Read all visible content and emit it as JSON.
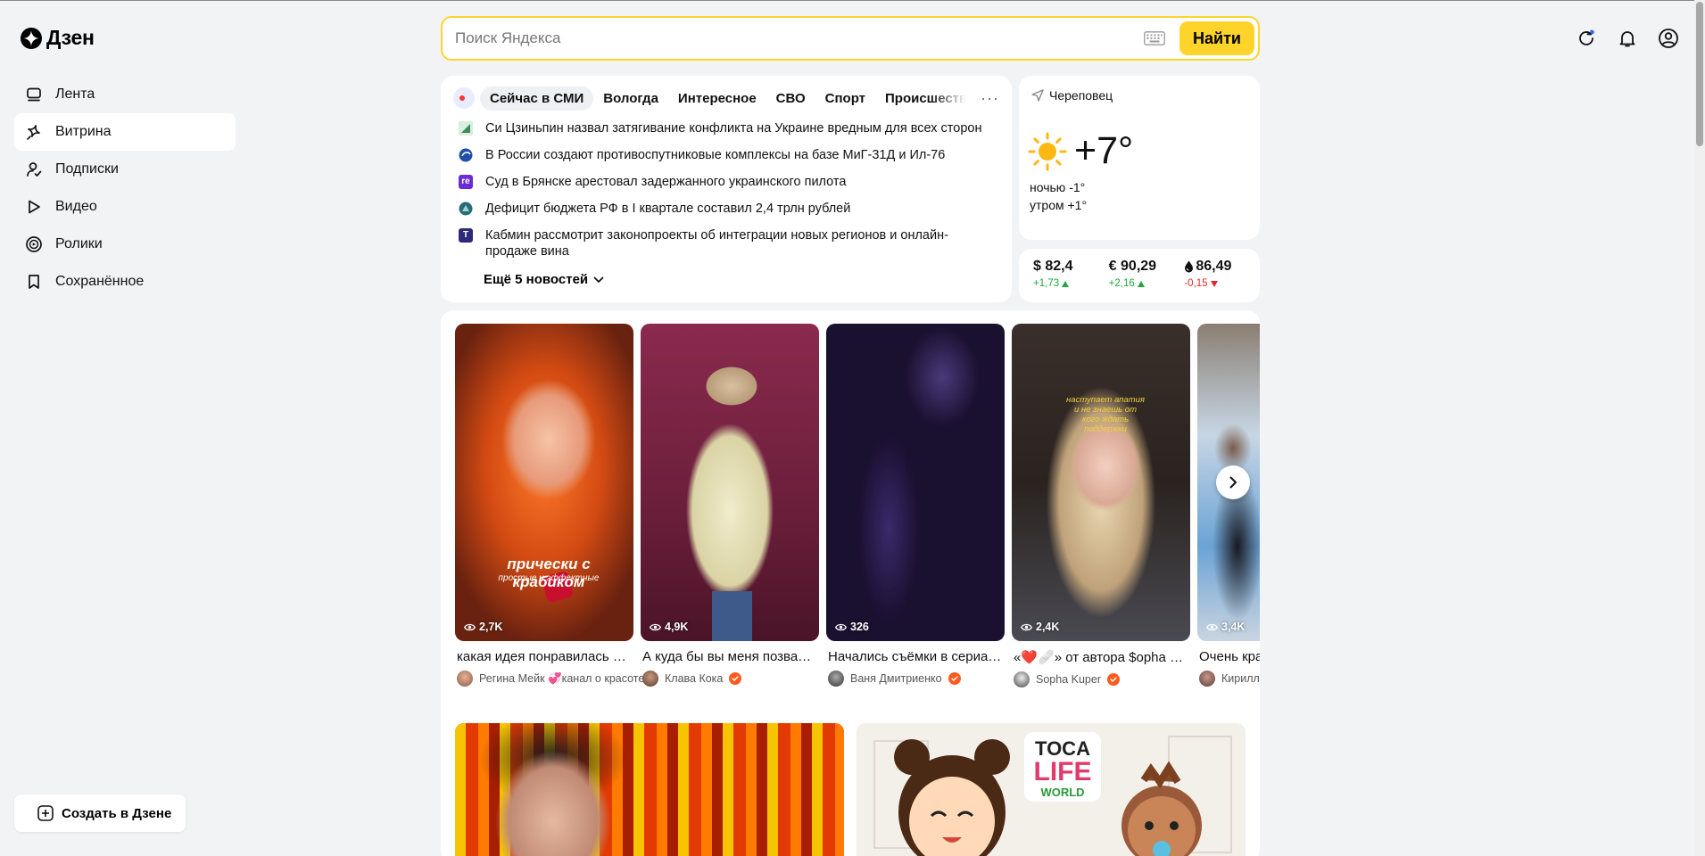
{
  "brand": {
    "name": "Дзен"
  },
  "sidebar": {
    "items": [
      {
        "label": "Лента",
        "icon": "feed-icon"
      },
      {
        "label": "Витрина",
        "icon": "sparkles-icon",
        "active": true
      },
      {
        "label": "Подписки",
        "icon": "subscriptions-icon"
      },
      {
        "label": "Видео",
        "icon": "play-icon"
      },
      {
        "label": "Ролики",
        "icon": "shorts-icon"
      },
      {
        "label": "Сохранённое",
        "icon": "bookmark-icon"
      }
    ],
    "create_label": "Создать в Дзене"
  },
  "search": {
    "placeholder": "Поиск Яндекса",
    "value": "",
    "button_label": "Найти",
    "accent": "#fed42b"
  },
  "header_icons": [
    "refresh-icon",
    "bell-icon",
    "profile-icon"
  ],
  "news": {
    "tabs": [
      "Сейчас в СМИ",
      "Вологда",
      "Интересное",
      "СВО",
      "Спорт",
      "Происшествия"
    ],
    "active_tab": 0,
    "items": [
      {
        "text": "Си Цзиньпин назвал затягивание конфликта на Украине вредным для всех сторон",
        "source_color": "#3d8c5a"
      },
      {
        "text": "В России создают противоспутниковые комплексы на базе МиГ-31Д и Ил-76",
        "source_color": "#1f4fa8"
      },
      {
        "text": "Суд в Брянске арестовал задержанного украинского пилота",
        "source_color": "#6a2bd9",
        "source_letters": "re"
      },
      {
        "text": "Дефицит бюджета РФ в I квартале составил 2,4 трлн рублей",
        "source_color": "#2a6b7a"
      },
      {
        "text": "Кабмин рассмотрит законопроекты об интеграции новых регионов и онлайн-продаже вина",
        "source_color": "#2e2a7a",
        "source_letters": "Т"
      }
    ],
    "more_label": "Ещё 5 новостей"
  },
  "weather": {
    "city": "Череповец",
    "temp": "+7°",
    "night": "ночью -1°",
    "morning": "утром +1°"
  },
  "rates": [
    {
      "value": "$ 82,4",
      "delta": "+1,73",
      "direction": "up"
    },
    {
      "value": "€ 90,29",
      "delta": "+2,16",
      "direction": "up"
    },
    {
      "value": "86,49",
      "delta": "-0,15",
      "direction": "down",
      "icon": "oil-drop-icon"
    }
  ],
  "shorts": [
    {
      "views": "2,7K",
      "title": "какая идея понравилась больше?",
      "author": "Регина Мейк 💞канал о красоте",
      "verified": false,
      "caption": "прически с крабиком",
      "caption_sub": "простые и эффектные"
    },
    {
      "views": "4,9K",
      "title": "А куда бы вы меня позвали?",
      "author": "Клава Кока",
      "verified": true
    },
    {
      "views": "326",
      "title": "Начались съёмки в сериале",
      "author": "Ваня Дмитриенко",
      "verified": true
    },
    {
      "views": "2,4K",
      "title": "«❤️🩹» от автора $opha Kuper",
      "author": "Sopha Kuper",
      "verified": true,
      "caption": "наступает апатия и не знаешь от кого ждать поддержки"
    },
    {
      "views": "3,4K",
      "title": "Очень красиво",
      "author": "Кирилл",
      "verified": false
    }
  ]
}
